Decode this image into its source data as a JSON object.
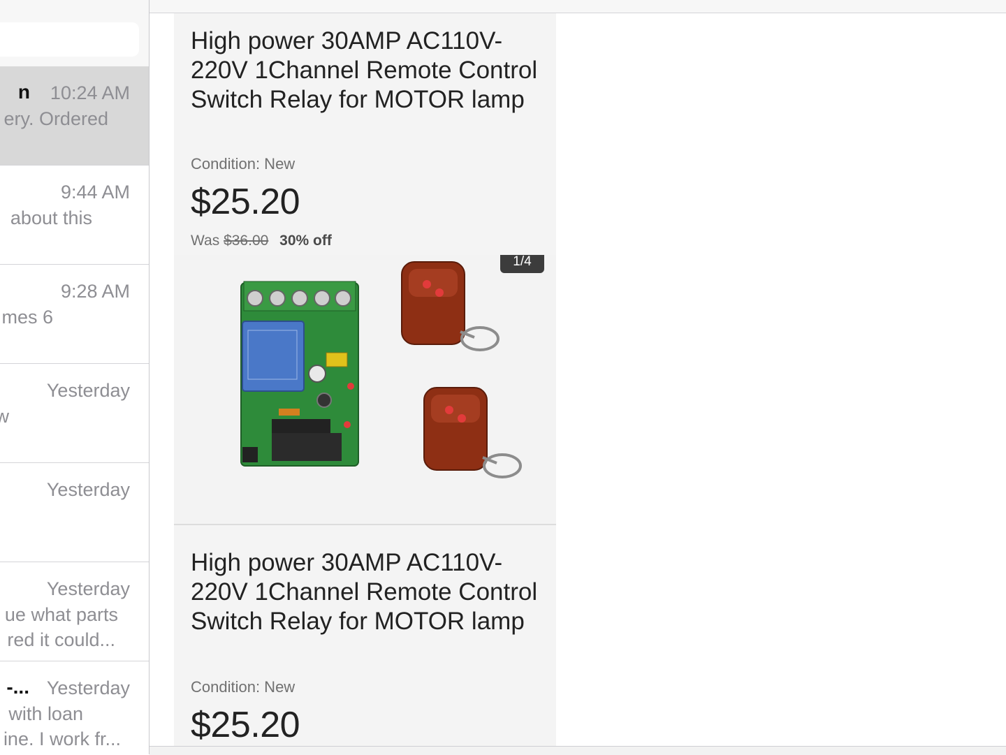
{
  "mail_list": {
    "items": [
      {
        "sender": "n",
        "time": "10:24 AM",
        "line1": "ery. Ordered",
        "line2": "",
        "selected": true
      },
      {
        "sender": "",
        "time": "9:44 AM",
        "line1": "about this",
        "line2": ""
      },
      {
        "sender": "",
        "time": "9:28 AM",
        "line1": "mes 6",
        "line2": ""
      },
      {
        "sender": "",
        "time": "Yesterday",
        "line1": "w",
        "line2": ""
      },
      {
        "sender": "",
        "time": "Yesterday",
        "line1": "",
        "line2": ""
      },
      {
        "sender": "",
        "time": "Yesterday",
        "line1": "ue what parts",
        "line2": "red it could..."
      },
      {
        "sender": "-...",
        "time": "Yesterday",
        "line1": "with loan",
        "line2": "ine. I work fr..."
      }
    ]
  },
  "listing1": {
    "title": "High power 30AMP AC110V-220V 1Channel Remote Control Switch Relay for MOTOR lamp",
    "condition": "Condition: New",
    "price": "$25.20",
    "was_label": "Was",
    "was_price": "$36.00",
    "discount": "30% off"
  },
  "gallery": {
    "counter": "1/4"
  },
  "listing2": {
    "title": "High power 30AMP AC110V-220V 1Channel Remote Control Switch Relay for MOTOR lamp",
    "condition": "Condition: New",
    "price": "$25.20"
  },
  "colors": {
    "selected_row": "#d8d8d8",
    "secondary_text": "#8e8e93",
    "pcb_green": "#2e8b3a",
    "relay_blue": "#4a78c8",
    "remote_red": "#8e2f14"
  }
}
